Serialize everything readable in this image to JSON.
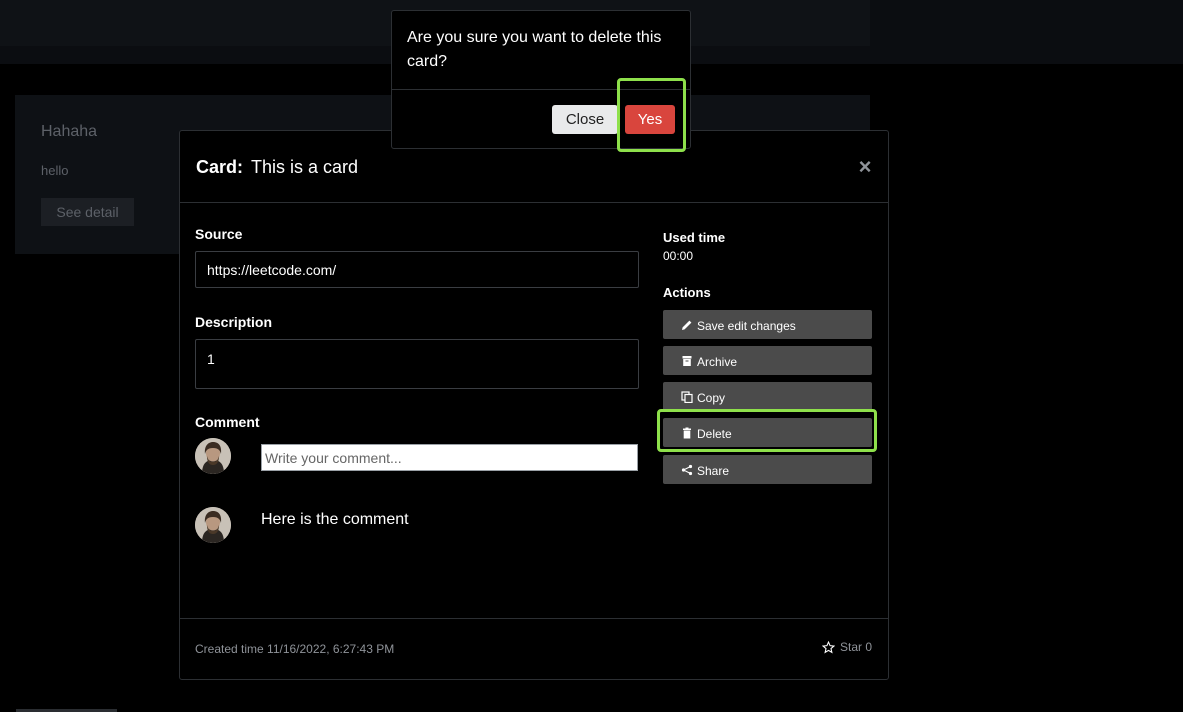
{
  "background": {
    "card_title": "Hahaha",
    "card_text": "hello",
    "card_button": "See detail"
  },
  "modal": {
    "title_label": "Card:",
    "title": "This is a card",
    "close_icon": "×",
    "source_label": "Source",
    "source_value": "https://leetcode.com/",
    "description_label": "Description",
    "description_value": "1",
    "comment_label": "Comment",
    "comment_placeholder": "Write your comment...",
    "comments": [
      {
        "text": "Here is the comment"
      }
    ],
    "used_time_label": "Used time",
    "used_time_value": "00:00",
    "actions_label": "Actions",
    "actions": [
      {
        "label": "Save edit changes",
        "icon": "pencil-icon"
      },
      {
        "label": "Archive",
        "icon": "archive-icon"
      },
      {
        "label": "Copy",
        "icon": "copy-icon"
      },
      {
        "label": "Delete",
        "icon": "trash-icon"
      },
      {
        "label": "Share",
        "icon": "share-icon"
      }
    ],
    "created_time": "Created time 11/16/2022, 6:27:43 PM",
    "star_label": "Star 0"
  },
  "confirm": {
    "message": "Are you sure you want to delete this card?",
    "close_label": "Close",
    "yes_label": "Yes"
  },
  "colors": {
    "highlight": "#8ee04b",
    "danger": "#d9453d",
    "action_button": "#4b4b4b"
  }
}
